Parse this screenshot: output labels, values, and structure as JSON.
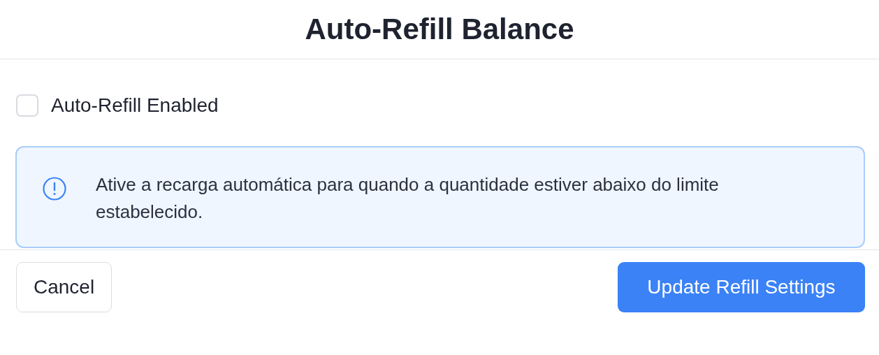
{
  "dialog": {
    "title": "Auto-Refill Balance"
  },
  "checkbox": {
    "label": "Auto-Refill Enabled",
    "checked": false
  },
  "info": {
    "text": "Ative a recarga automática para quando a quantidade estiver abaixo do limite estabelecido."
  },
  "buttons": [
    {
      "label": "Cancel",
      "kind": "secondary"
    },
    {
      "label": "Update Refill Settings",
      "kind": "primary"
    }
  ]
}
